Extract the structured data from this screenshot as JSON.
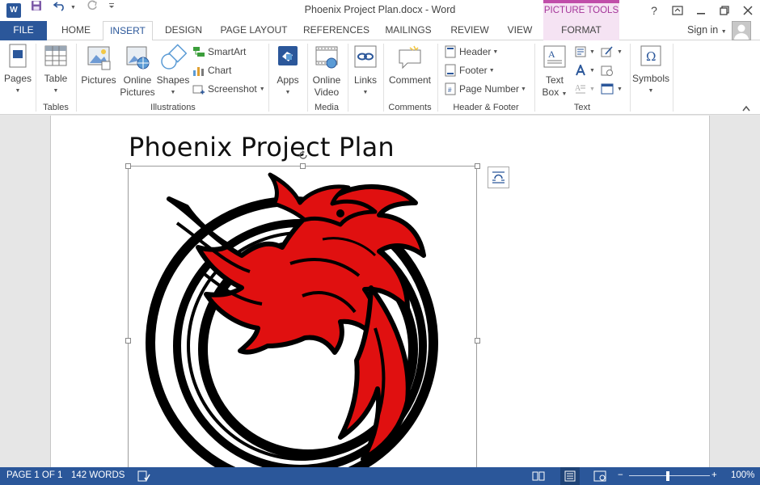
{
  "app": {
    "title": "Phoenix Project Plan.docx - Word",
    "context_tab_group": "PICTURE TOOLS",
    "signin": "Sign in",
    "help": "?"
  },
  "tabs": [
    {
      "label": "FILE"
    },
    {
      "label": "HOME"
    },
    {
      "label": "INSERT"
    },
    {
      "label": "DESIGN"
    },
    {
      "label": "PAGE LAYOUT"
    },
    {
      "label": "REFERENCES"
    },
    {
      "label": "MAILINGS"
    },
    {
      "label": "REVIEW"
    },
    {
      "label": "VIEW"
    },
    {
      "label": "FORMAT"
    }
  ],
  "ribbon": {
    "pages": "Pages",
    "table": "Table",
    "pictures": "Pictures",
    "online_pictures_1": "Online",
    "online_pictures_2": "Pictures",
    "shapes": "Shapes",
    "smartart": "SmartArt",
    "chart": "Chart",
    "screenshot": "Screenshot",
    "apps": "Apps",
    "online_video_1": "Online",
    "online_video_2": "Video",
    "links": "Links",
    "comment": "Comment",
    "header": "Header",
    "footer": "Footer",
    "page_number": "Page Number",
    "text_box_1": "Text",
    "text_box_2": "Box",
    "symbols": "Symbols",
    "groups": {
      "tables": "Tables",
      "illustrations": "Illustrations",
      "media": "Media",
      "comments": "Comments",
      "header_footer": "Header & Footer",
      "text": "Text"
    }
  },
  "document": {
    "title": "Phoenix Project Plan"
  },
  "status": {
    "page": "PAGE 1 OF 1",
    "words": "142 WORDS",
    "zoom": "100%",
    "zoom_minus": "−",
    "zoom_plus": "+"
  },
  "colors": {
    "brand": "#2b579a",
    "context": "#c04ea9"
  }
}
